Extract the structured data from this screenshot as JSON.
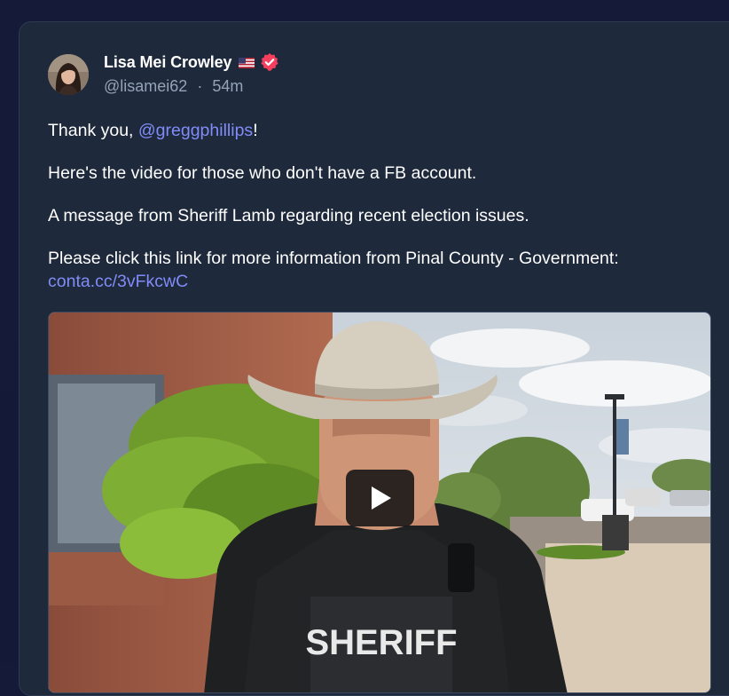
{
  "post": {
    "author": {
      "display_name": "Lisa Mei Crowley",
      "handle": "@lisamei62",
      "separator": "·",
      "time_ago": "54m",
      "flag_icon": "us-flag-icon",
      "verified_icon": "verified-badge-icon"
    },
    "text": {
      "line1_prefix": "Thank you, ",
      "line1_mention": "@greggphillips",
      "line1_suffix": "!",
      "line2": "Here's the video for those who don't have a FB account.",
      "line3": "A message from Sheriff Lamb regarding recent election issues.",
      "line4": "Please click this link for more information from Pinal County - Government:",
      "line4_link": "conta.cc/3vFkcwC"
    },
    "media": {
      "type": "video",
      "vest_label": "SHERIFF",
      "play_icon": "play-icon"
    }
  },
  "colors": {
    "page_bg": "#141a38",
    "card_bg": "#1e293b",
    "link": "#818cf8",
    "handle": "#94a3b8",
    "verified": "#f43f5e"
  }
}
